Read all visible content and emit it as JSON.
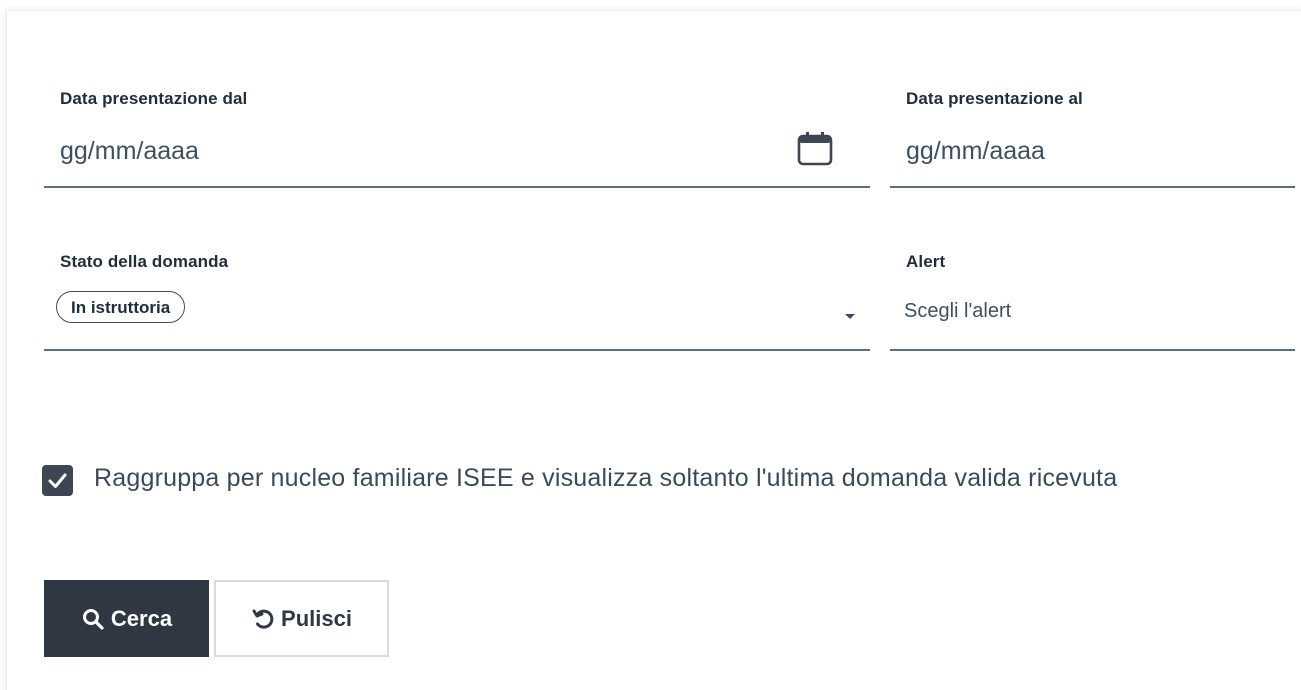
{
  "filters": {
    "date_from": {
      "label": "Data presentazione dal",
      "placeholder": "gg/mm/aaaa",
      "icon": "calendar-icon"
    },
    "date_to": {
      "label": "Data presentazione al",
      "placeholder": "gg/mm/aaaa"
    },
    "status": {
      "label": "Stato della domanda",
      "selected_chip": "In istruttoria",
      "icon": "chevron-down-icon"
    },
    "alert": {
      "label": "Alert",
      "placeholder": "Scegli l'alert"
    }
  },
  "group_option": {
    "checked": true,
    "label": "Raggruppa per nucleo familiare ISEE e visualizza soltanto l'ultima domanda valida ricevuta"
  },
  "actions": {
    "search_label": "Cerca",
    "search_icon": "search-icon",
    "clear_label": "Pulisci",
    "clear_icon": "undo-icon"
  },
  "colors": {
    "primary_button": "#2f3842",
    "field_underline": "#5c6f82",
    "text": "#1f2d3d"
  }
}
